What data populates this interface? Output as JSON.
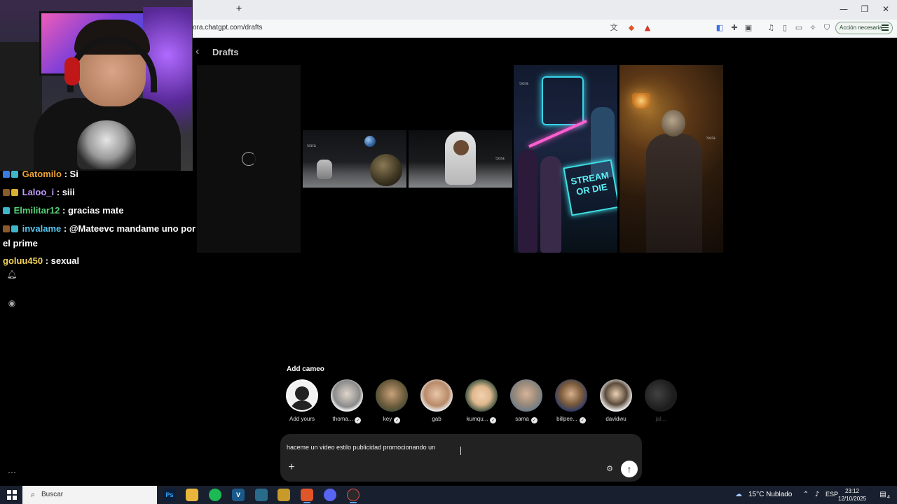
{
  "browser": {
    "url": "ora.chatgpt.com/drafts",
    "new_tab": "+",
    "action_button": "Acción necesaria",
    "window_controls": {
      "minimize": "—",
      "maximize": "❐",
      "close": "✕"
    }
  },
  "page": {
    "title": "Drafts",
    "back": "‹"
  },
  "drafts": [
    {
      "state": "loading"
    },
    {
      "watermark": "Sora"
    },
    {
      "watermark": "Sora"
    },
    {
      "watermark": "Sora",
      "sign_line1": "STREAM",
      "sign_line2": "OR DIE"
    },
    {
      "watermark": "Sora"
    }
  ],
  "chat": [
    {
      "name": "Gatomilo",
      "name_color": "#f0a43a",
      "message": ": Si"
    },
    {
      "name": "Laloo_i",
      "name_color": "#c39cff",
      "message": ": siii"
    },
    {
      "name": "Elmilitar12",
      "name_color": "#59d17a",
      "message": ": gracias mate"
    },
    {
      "name": "invalame",
      "name_color": "#58c7f0",
      "message": ": @Mateevc mandame uno por"
    },
    {
      "continuation": "el prime"
    },
    {
      "name": "goluu450",
      "name_color": "#f2d35a",
      "message": ": sexual"
    }
  ],
  "cameo": {
    "title": "Add cameo",
    "items": [
      {
        "name": "Add yours",
        "verified": false
      },
      {
        "name": "thoma...",
        "verified": true
      },
      {
        "name": "key",
        "verified": true
      },
      {
        "name": "gab",
        "verified": false
      },
      {
        "name": "kumqu...",
        "verified": true
      },
      {
        "name": "sama",
        "verified": true
      },
      {
        "name": "billpee...",
        "verified": true
      },
      {
        "name": "davidwu",
        "verified": false
      },
      {
        "name": "jal...",
        "verified": false
      }
    ]
  },
  "composer": {
    "text": "haceme un video estilo publicidad promocionando un",
    "plus": "+",
    "send": "↑",
    "settings": "⚙"
  },
  "taskbar": {
    "search_label": "Buscar",
    "weather": "15°C  Nublado",
    "language": "ESP",
    "time": "23:12",
    "date": "12/10/2025",
    "notification_count": "4"
  }
}
